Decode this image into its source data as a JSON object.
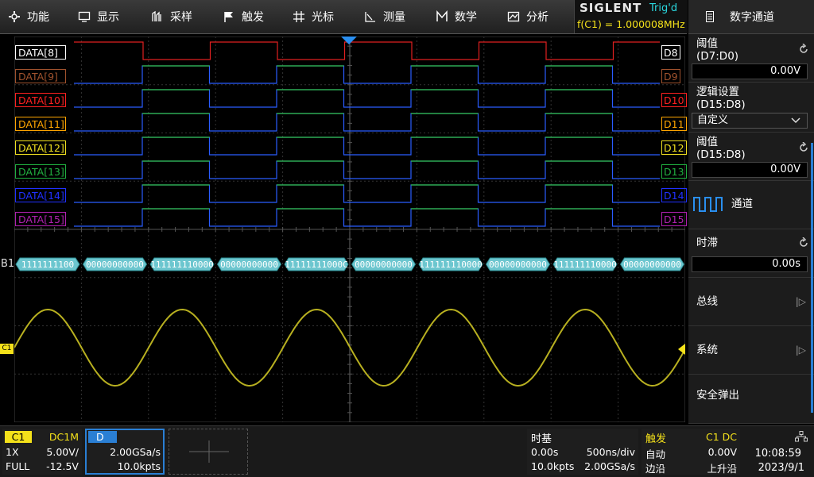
{
  "menu": {
    "items": [
      {
        "label": "功能",
        "icon": "gear-icon"
      },
      {
        "label": "显示",
        "icon": "monitor-icon"
      },
      {
        "label": "采样",
        "icon": "sample-icon"
      },
      {
        "label": "触发",
        "icon": "flag-icon"
      },
      {
        "label": "光标",
        "icon": "cursor-icon"
      },
      {
        "label": "测量",
        "icon": "measure-icon"
      },
      {
        "label": "数学",
        "icon": "math-icon"
      },
      {
        "label": "分析",
        "icon": "analysis-icon"
      }
    ]
  },
  "status": {
    "brand": "SIGLENT",
    "trigger_state": "Trig'd",
    "frequency": "f(C1) = 1.000008MHz"
  },
  "right_panel": {
    "title": "数字通道",
    "threshold1_label": "阈值",
    "threshold1_sub": "(D7:D0)",
    "threshold1_value": "0.00V",
    "logic_label": "逻辑设置",
    "logic_sub": "(D15:D8)",
    "logic_value": "自定义",
    "threshold2_label": "阈值",
    "threshold2_sub": "(D15:D8)",
    "threshold2_value": "0.00V",
    "channel_label": "通道",
    "skew_label": "时滞",
    "skew_value": "0.00s",
    "bus_label": "总线",
    "system_label": "系统",
    "safe_eject_label": "安全弹出"
  },
  "channels": [
    {
      "label": "DATA[8]",
      "tag": "D8",
      "color": "#ffffff",
      "trace": "#e02020"
    },
    {
      "label": "DATA[9]",
      "tag": "D9",
      "color": "#a0522d",
      "trace": "#2a5cff"
    },
    {
      "label": "DATA[10]",
      "tag": "D10",
      "color": "#ff2020",
      "trace": "#2a5cff"
    },
    {
      "label": "DATA[11]",
      "tag": "D11",
      "color": "#ffa500",
      "trace": "#2a5cff"
    },
    {
      "label": "DATA[12]",
      "tag": "D12",
      "color": "#f0e020",
      "trace": "#2a5cff"
    },
    {
      "label": "DATA[13]",
      "tag": "D13",
      "color": "#20b040",
      "trace": "#2a5cff"
    },
    {
      "label": "DATA[14]",
      "tag": "D14",
      "color": "#2030ff",
      "trace": "#2a5cff"
    },
    {
      "label": "DATA[15]",
      "tag": "D15",
      "color": "#b020b0",
      "trace": "#2a5cff"
    }
  ],
  "bus": {
    "label": "B1",
    "values": [
      "1111111100",
      "00000000000",
      "111111110000",
      "00000000000",
      "11111111000C",
      "00000000000",
      "111111110000",
      "00000000000",
      "111111110000",
      "00000000000"
    ]
  },
  "analog": {
    "marker": "C1",
    "color": "#b8b020"
  },
  "bottom": {
    "c1": {
      "name": "C1",
      "coupling": "DC1M",
      "probe": "1X",
      "scale": "5.00V/",
      "bw": "FULL",
      "offset": "-12.5V"
    },
    "digital": {
      "name": "D",
      "rate": "2.00GSa/s",
      "points": "10.0kpts"
    },
    "timebase": {
      "title": "时基",
      "delay": "0.00s",
      "scale": "500ns/div",
      "points": "10.0kpts",
      "rate": "2.00GSa/s"
    },
    "trigger": {
      "title": "触发",
      "source": "C1 DC",
      "mode": "自动",
      "level": "0.00V",
      "type": "边沿",
      "slope": "上升沿"
    },
    "clock": {
      "time": "10:08:59",
      "date": "2023/9/1"
    }
  }
}
